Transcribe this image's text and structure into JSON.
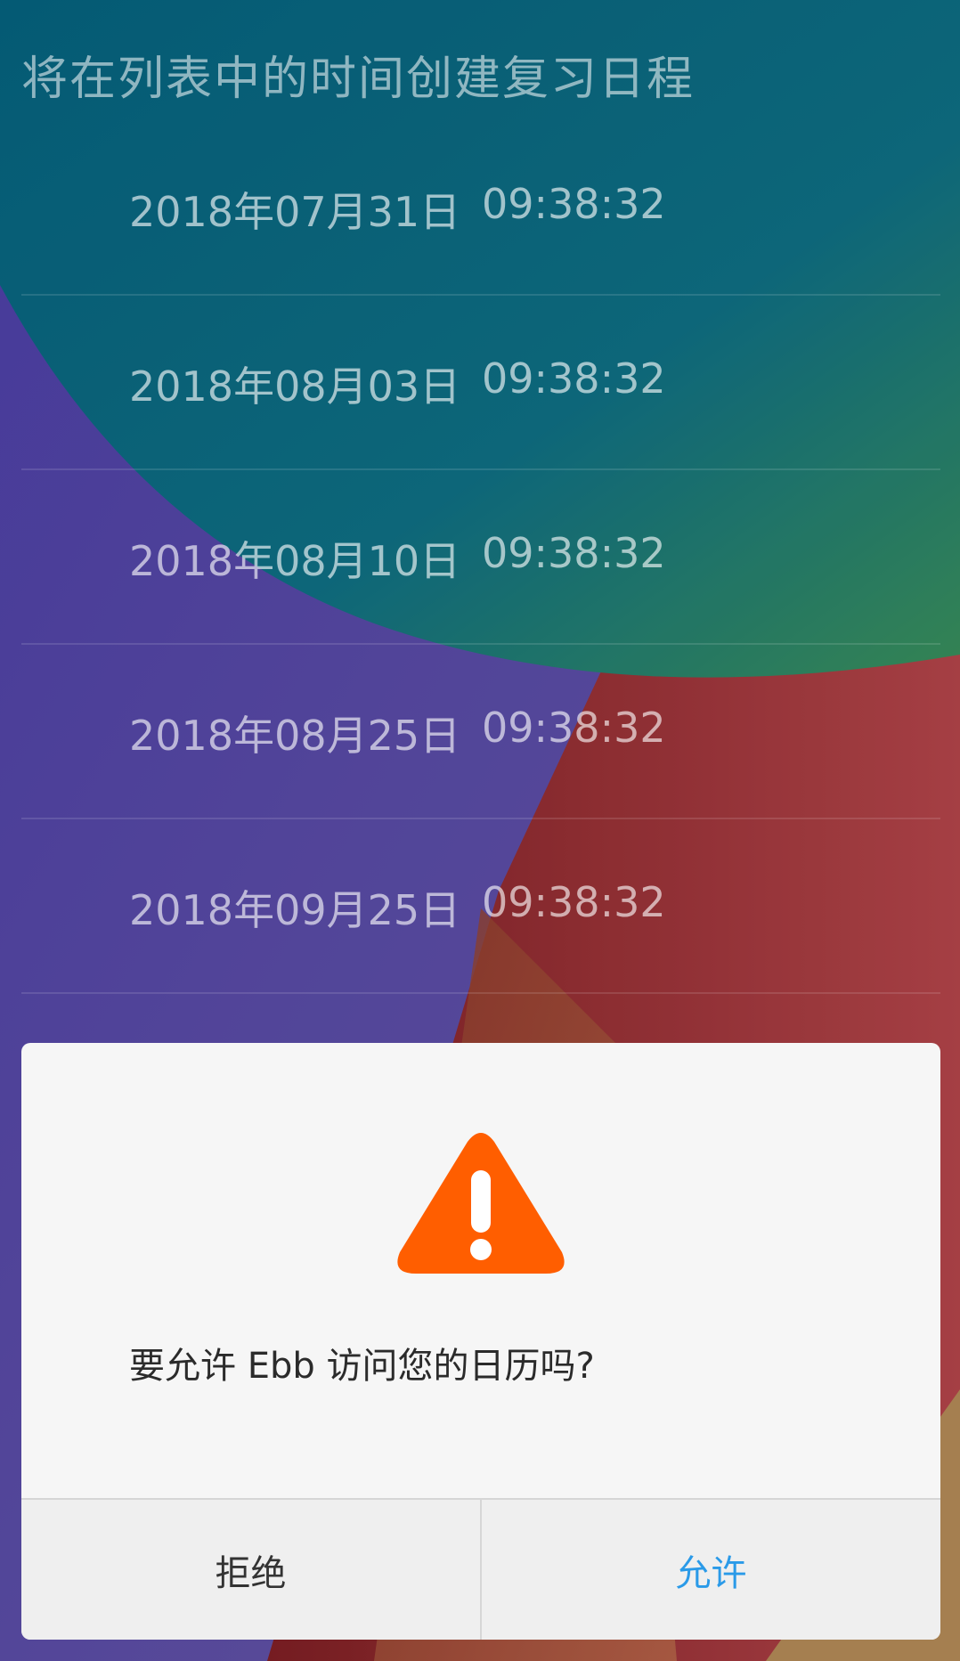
{
  "page": {
    "title": "将在列表中的时间创建复习日程"
  },
  "schedule": [
    {
      "date": "2018年07月31日",
      "time": "09:38:32"
    },
    {
      "date": "2018年08月03日",
      "time": "09:38:32"
    },
    {
      "date": "2018年08月10日",
      "time": "09:38:32"
    },
    {
      "date": "2018年08月25日",
      "time": "09:38:32"
    },
    {
      "date": "2018年09月25日",
      "time": "09:38:32"
    }
  ],
  "dialog": {
    "icon": "warning-icon",
    "message": "要允许 Ebb 访问您的日历吗?",
    "deny_label": "拒绝",
    "allow_label": "允许"
  },
  "colors": {
    "accent": "#2a9ae8",
    "warning": "#ff5e00",
    "wallpaper_teal": "#0c6f86",
    "wallpaper_purple": "#5546a6",
    "wallpaper_red": "#9a2d33"
  }
}
